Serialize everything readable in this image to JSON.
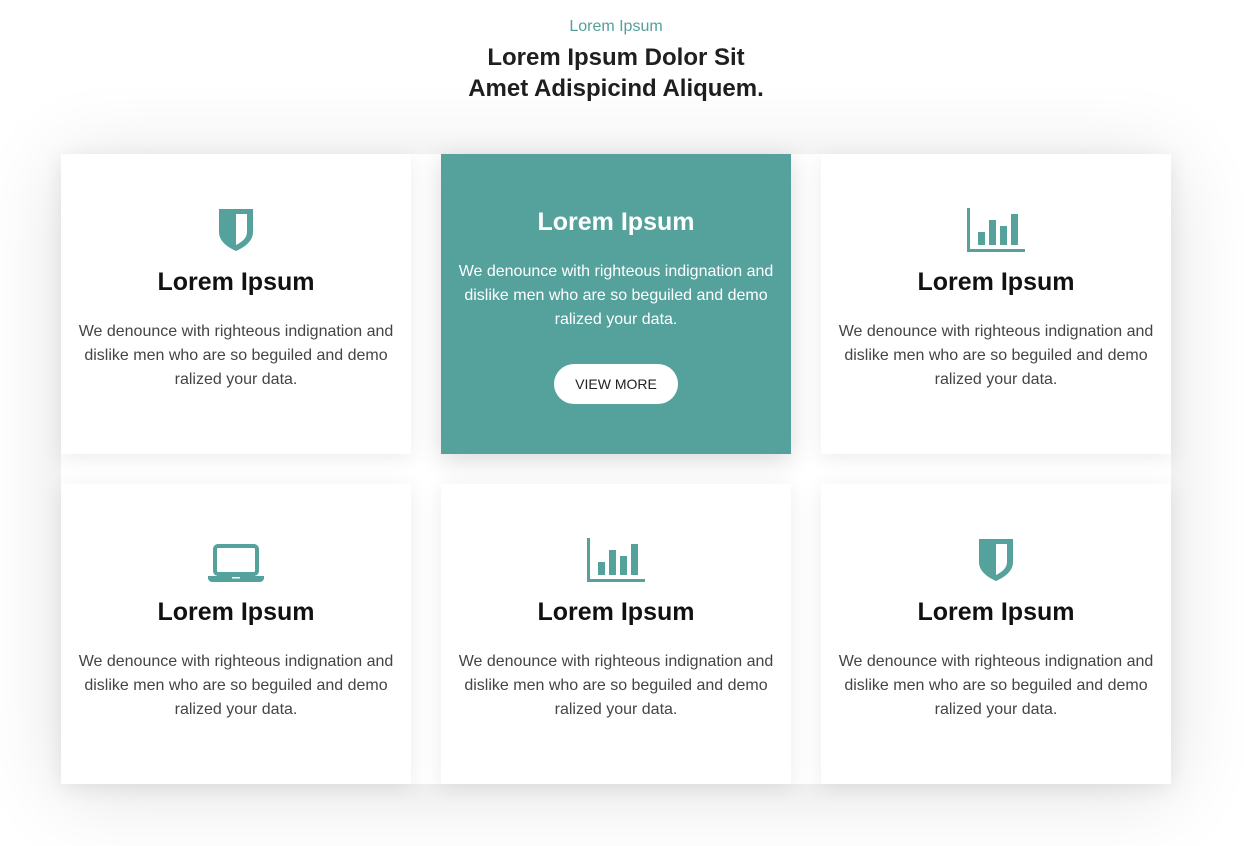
{
  "section": {
    "kicker": "Lorem Ipsum",
    "headline_line1": "Lorem Ipsum Dolor Sit",
    "headline_line2": "Amet Adispicind Aliquem."
  },
  "colors": {
    "accent": "#55a19c",
    "background": "#ffffff",
    "title": "#111111",
    "body_text": "#444444"
  },
  "cards": [
    {
      "icon": "shield-icon",
      "title": "Lorem Ipsum",
      "text": "We denounce with righteous indignation and dislike men who are so beguiled and demo ralized your data."
    },
    {
      "icon": null,
      "title": "Lorem Ipsum",
      "text": "We denounce with righteous indignation and dislike men who are so beguiled and demo ralized your data.",
      "button_label": "VIEW MORE",
      "featured": true
    },
    {
      "icon": "bar-chart-icon",
      "title": "Lorem Ipsum",
      "text": "We denounce with righteous indignation and dislike men who are so beguiled and demo ralized your data."
    },
    {
      "icon": "laptop-icon",
      "title": "Lorem Ipsum",
      "text": "We denounce with righteous indignation and dislike men who are so beguiled and demo ralized your data."
    },
    {
      "icon": "bar-chart-icon",
      "title": "Lorem Ipsum",
      "text": "We denounce with righteous indignation and dislike men who are so beguiled and demo ralized your data."
    },
    {
      "icon": "shield-icon",
      "title": "Lorem Ipsum",
      "text": "We denounce with righteous indignation and dislike men who are so beguiled and demo ralized your data."
    }
  ]
}
